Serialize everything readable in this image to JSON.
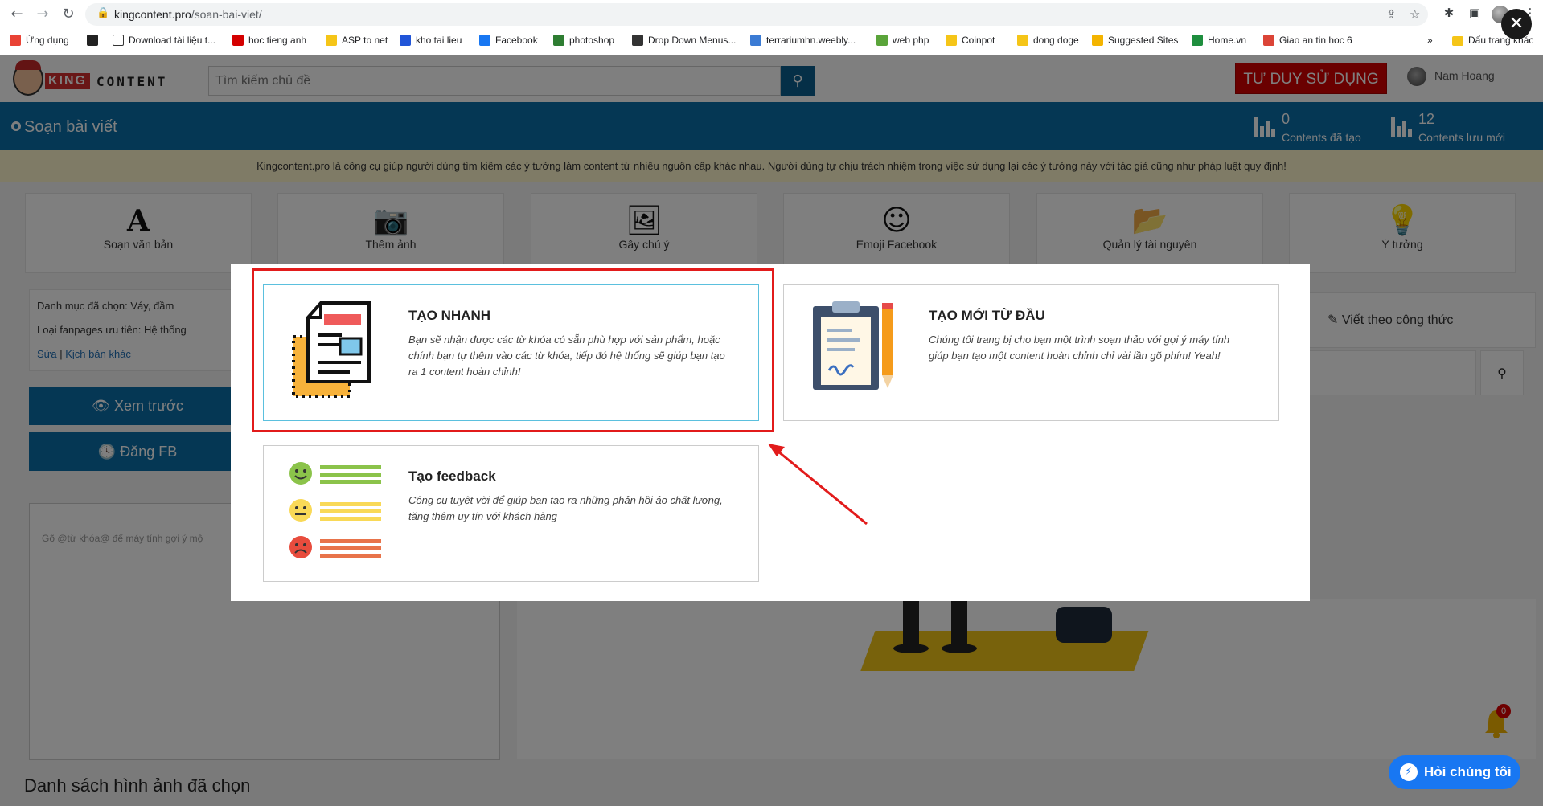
{
  "browser": {
    "url_host": "kingcontent.pro",
    "url_path": "/soan-bai-viet/",
    "bookmarks": [
      {
        "label": "Ứng dụng",
        "color": "#e94235"
      },
      {
        "label": "",
        "color": "#222222"
      },
      {
        "label": "Download tài liệu t...",
        "color": "#ffffff"
      },
      {
        "label": "hoc tieng anh",
        "color": "#d40000"
      },
      {
        "label": "ASP to net",
        "color": "#f5c518"
      },
      {
        "label": "kho tai lieu",
        "color": "#2155d8"
      },
      {
        "label": "Facebook",
        "color": "#1877f2"
      },
      {
        "label": "photoshop",
        "color": "#2e7d32"
      },
      {
        "label": "Drop Down Menus...",
        "color": "#333333"
      },
      {
        "label": "terrariumhn.weebly...",
        "color": "#3b7bd4"
      },
      {
        "label": "web php",
        "color": "#5aa43a"
      },
      {
        "label": "Coinpot",
        "color": "#f5c518"
      },
      {
        "label": "dong doge",
        "color": "#f5c518"
      },
      {
        "label": "Suggested Sites",
        "color": "#f4b400"
      },
      {
        "label": "Home.vn",
        "color": "#1e8e3e"
      },
      {
        "label": "Giao an tin hoc 6",
        "color": "#db4437"
      }
    ],
    "more_bookmarks_label": "»",
    "other_bookmarks_label": "Dấu trang khác"
  },
  "header": {
    "logo_king": "KING",
    "logo_content": "CONTENT",
    "search_placeholder": "Tìm kiếm chủ đề",
    "tu_duy_label": "TƯ DUY SỬ DỤNG",
    "user_name": "Nam Hoang"
  },
  "bluebar": {
    "title": "Soạn bài viết",
    "stats": [
      {
        "num": "0",
        "label": "Contents đã tạo"
      },
      {
        "num": "12",
        "label": "Contents lưu mới"
      }
    ]
  },
  "notice": "Kingcontent.pro là công cụ giúp người dùng tìm kiếm các ý tưởng làm content từ nhiều nguồn cấp khác nhau. Người dùng tự chịu trách nhiệm trong việc sử dụng lại các ý tưởng này với tác giả cũng như pháp luật quy định!",
  "tools": [
    {
      "label": "Soạn văn bản",
      "icon": "A"
    },
    {
      "label": "Thêm ảnh",
      "icon": "📷"
    },
    {
      "label": "Gây chú ý",
      "icon": "🖼"
    },
    {
      "label": "Emoji Facebook",
      "icon": "☺"
    },
    {
      "label": "Quản lý tài nguyên",
      "icon": "📂"
    },
    {
      "label": "Ý tưởng",
      "icon": "💡"
    }
  ],
  "left_panel": {
    "category_line": "Danh mục đã chọn: Váy, đầm",
    "fanpage_line": "Loại fanpages ưu tiên: Hệ thống",
    "edit_link": "Sửa",
    "separator": "|",
    "other_script_link": "Kịch bản khác",
    "preview_button": "Xem trước",
    "post_fb_button": "Đăng FB",
    "editor_placeholder": "Gõ @từ khóa@ để máy tính gợi ý mộ",
    "image_list_title": "Danh sách hình ảnh đã chọn"
  },
  "right_panel": {
    "formula_label": "Viết theo công thức"
  },
  "modal": {
    "cards": [
      {
        "title": "TẠO NHANH",
        "desc": "Bạn sẽ nhận được các từ khóa có sẵn phù hợp với sản phẩm, hoặc chính bạn tự thêm vào các từ khóa, tiếp đó hệ thống sẽ giúp bạn tạo ra 1 content hoàn chỉnh!"
      },
      {
        "title": "TẠO MỚI TỪ ĐẦU",
        "desc": "Chúng tôi trang bị cho bạn một trình soạn thảo với gợi ý máy tính giúp bạn tạo một content hoàn chỉnh chỉ vài lần gõ phím! Yeah!"
      },
      {
        "title": "Tạo feedback",
        "desc": "Công cụ tuyệt vời để giúp bạn tạo ra những phản hồi ảo chất lượng, tăng thêm uy tín với khách hàng"
      }
    ]
  },
  "floating": {
    "notification_count": "0",
    "chat_label": "Hỏi chúng tôi"
  },
  "colors": {
    "brand_blue": "#0a6ea8",
    "brand_red": "#d40000",
    "highlight_red": "#e21b1b",
    "messenger_blue": "#1877f2"
  }
}
